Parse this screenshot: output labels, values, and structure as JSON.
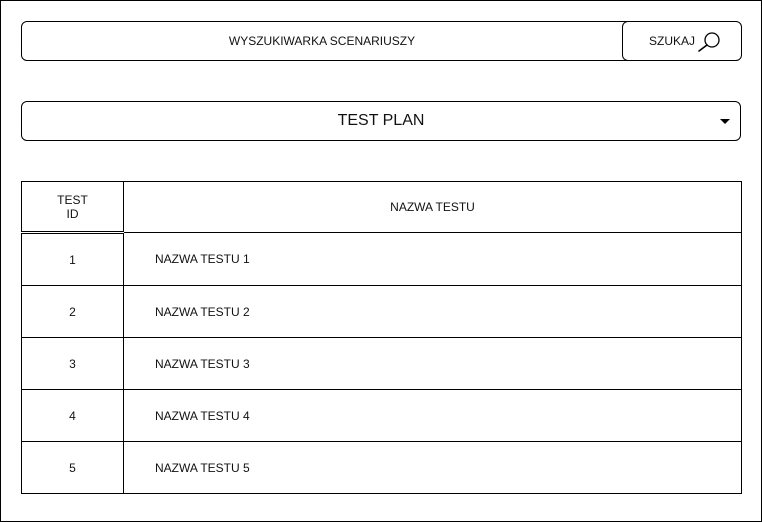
{
  "search": {
    "placeholder": "WYSZUKIWARKA SCENARIUSZY",
    "button_label": "SZUKAJ",
    "button_icon": "magnifier-icon"
  },
  "plan_select": {
    "selected": "TEST PLAN",
    "icon": "caret-down-icon"
  },
  "table": {
    "headers": {
      "id_line1": "TEST",
      "id_line2": "ID",
      "name": "NAZWA TESTU"
    },
    "rows": [
      {
        "id": "1",
        "name": "NAZWA TESTU 1"
      },
      {
        "id": "2",
        "name": "NAZWA TESTU 2"
      },
      {
        "id": "3",
        "name": "NAZWA TESTU 3"
      },
      {
        "id": "4",
        "name": "NAZWA TESTU 4"
      },
      {
        "id": "5",
        "name": "NAZWA TESTU 5"
      }
    ]
  }
}
